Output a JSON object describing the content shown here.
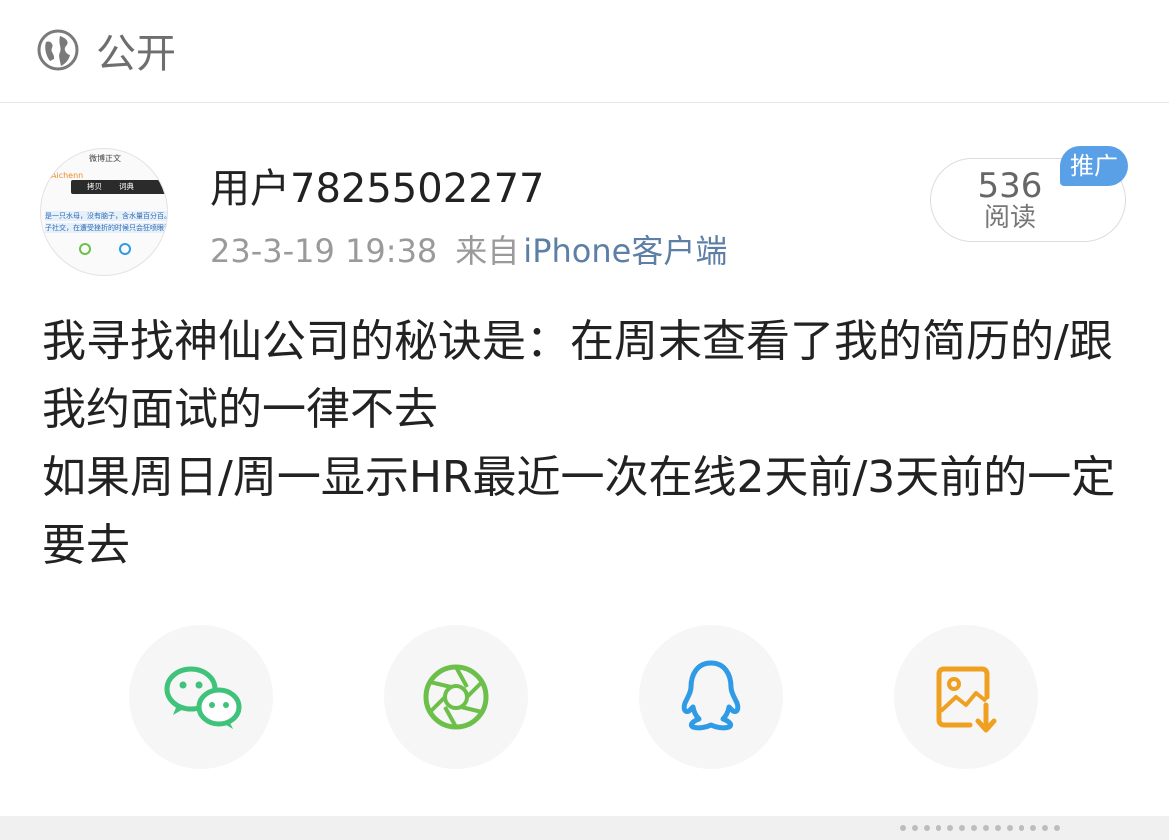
{
  "header": {
    "visibility_icon": "globe-icon",
    "visibility_label": "公开"
  },
  "post": {
    "avatar": {
      "screenshot_title": "微博正文",
      "screenshot_name": "Aichenn",
      "popup_copy": "拷贝",
      "popup_dict": "词典",
      "line1": "是一只水母，没有脑子，含水量百分百。",
      "line2": "子社交，在遭受挫折的时候只会狂喷眼泪"
    },
    "username": "用户7825502277",
    "timestamp": "23-3-19 19:38",
    "from_label": "来自",
    "source": "iPhone客户端",
    "reads_count": "536",
    "reads_unit": "阅读",
    "promo_badge": "推广",
    "content_lines": [
      "我寻找神仙公司的秘诀是：在周末查看了我的简历的/跟我约面试的一律不去",
      "如果周日/周一显示HR最近一次在线2天前/3天前的一定要去"
    ]
  },
  "share": {
    "buttons": [
      {
        "icon": "wechat-icon",
        "color": "#3fc27a"
      },
      {
        "icon": "moments-icon",
        "color": "#6cc04a"
      },
      {
        "icon": "qq-icon",
        "color": "#2f9be6"
      },
      {
        "icon": "save-image-icon",
        "color": "#f0a020"
      }
    ]
  }
}
